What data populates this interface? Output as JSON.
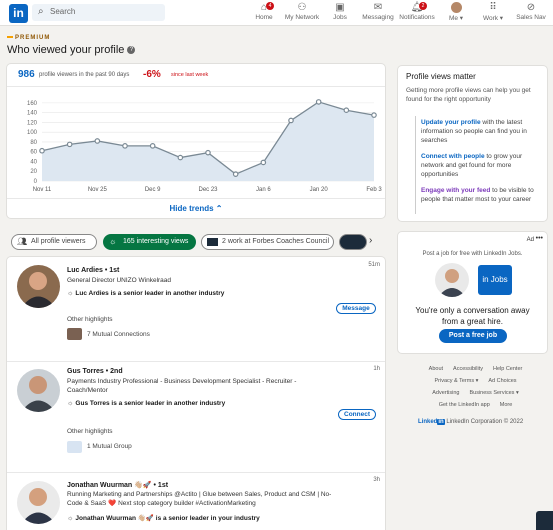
{
  "nav": {
    "logo": "in",
    "search_placeholder": "Search",
    "items": [
      {
        "label": "Home",
        "icon": "home-icon",
        "badge": "4"
      },
      {
        "label": "My Network",
        "icon": "network-icon",
        "badge": ""
      },
      {
        "label": "Jobs",
        "icon": "jobs-icon",
        "badge": ""
      },
      {
        "label": "Messaging",
        "icon": "messaging-icon",
        "badge": ""
      },
      {
        "label": "Notifications",
        "icon": "bell-icon",
        "badge": "2"
      },
      {
        "label": "Me ▾",
        "icon": "avatar",
        "badge": ""
      },
      {
        "label": "Work ▾",
        "icon": "grid-icon",
        "badge": ""
      },
      {
        "label": "Sales Nav",
        "icon": "compass-icon",
        "badge": ""
      }
    ]
  },
  "premium_label": "PREMIUM",
  "page_title": "Who viewed your profile",
  "stats": {
    "viewers": "986",
    "viewers_label": "profile viewers in the past 90 days",
    "change": "-6%",
    "change_label": "since last week"
  },
  "chart_data": {
    "type": "area",
    "x": [
      "Nov 11",
      "Nov 18",
      "Nov 25",
      "Dec 2",
      "Dec 9",
      "Dec 16",
      "Dec 23",
      "Dec 30",
      "Jan 6",
      "Jan 13",
      "Jan 20",
      "Jan 27",
      "Feb 3"
    ],
    "xticks": [
      "Nov 11",
      "Nov 25",
      "Dec 9",
      "Dec 23",
      "Jan 6",
      "Jan 20",
      "Feb 3"
    ],
    "series": [
      {
        "values": [
          62,
          75,
          82,
          72,
          72,
          48,
          58,
          14,
          38,
          124,
          162,
          145,
          135
        ]
      }
    ],
    "yticks": [
      "0",
      "20",
      "40",
      "60",
      "80",
      "100",
      "120",
      "140",
      "160"
    ],
    "ylim": [
      0,
      170
    ],
    "grid": true,
    "colors": {
      "line": "#7a8994",
      "fill": "#dde7f1",
      "point": "#7a8994"
    }
  },
  "hide_trends": "Hide trends ⌃",
  "filters": [
    {
      "label": "All profile viewers",
      "icon": "people-icon",
      "active": false
    },
    {
      "label": "165 interesting views",
      "icon": "sparkle-icon",
      "active": true
    },
    {
      "label": "2 work at Forbes Coaches Council",
      "icon": "company-logo-icon",
      "active": false
    }
  ],
  "viewers": [
    {
      "name": "Luc Ardies • 1st",
      "headline": "General Director UNIZO Winkelraad",
      "insight": "Luc Ardies is a senior leader in another industry",
      "other_label": "Other highlights",
      "highlight": "7 Mutual Connections",
      "time": "51m",
      "action": "Message"
    },
    {
      "name": "Gus Torres • 2nd",
      "headline": "Payments Industry Professional - Business Development Specialist - Recruiter - Coach/Mentor",
      "insight": "Gus Torres is a senior leader in another industry",
      "other_label": "Other highlights",
      "highlight": "1 Mutual Group",
      "time": "1h",
      "action": "Connect"
    },
    {
      "name": "Jonathan Wuurman 👋🏼🚀 • 1st",
      "headline": "Running Marketing and Partnerships @Actito | Glue between Sales, Product and CSM | No-Code & SaaS ❤️ Next stop category builder #ActivationMarketing",
      "insight": "Jonathan Wuurman 👋🏼🚀 is a senior leader in your industry",
      "time": "3h"
    }
  ],
  "side": {
    "title": "Profile views matter",
    "desc": "Getting more profile views can help you get found for the right opportunity",
    "tips": [
      {
        "lead": "Update your profile",
        "rest": " with the latest information so people can find you in searches",
        "color": "#0a66c2"
      },
      {
        "lead": "Connect with people",
        "rest": " to grow your network and get found for more opportunities",
        "color": "#0a66c2"
      },
      {
        "lead": "Engage with your feed",
        "rest": " to be visible to people that matter most to your career",
        "color": "#7c3aba"
      }
    ]
  },
  "ad": {
    "label": "Ad",
    "dots": "•••",
    "headline": "Post a job for free with LinkedIn Jobs.",
    "jobs_badge": "in Jobs",
    "tagline": "You're only a conversation away from a great hire.",
    "cta": "Post a free job"
  },
  "footer": {
    "row1": [
      "About",
      "Accessibility",
      "Help Center"
    ],
    "row2": [
      "Privacy & Terms ▾",
      "Ad Choices"
    ],
    "row3": [
      "Advertising",
      "Business Services ▾"
    ],
    "row4": [
      "Get the LinkedIn app",
      "More"
    ],
    "brand": "Linked",
    "brand_in": "in",
    "copyright": "LinkedIn Corporation © 2022"
  }
}
